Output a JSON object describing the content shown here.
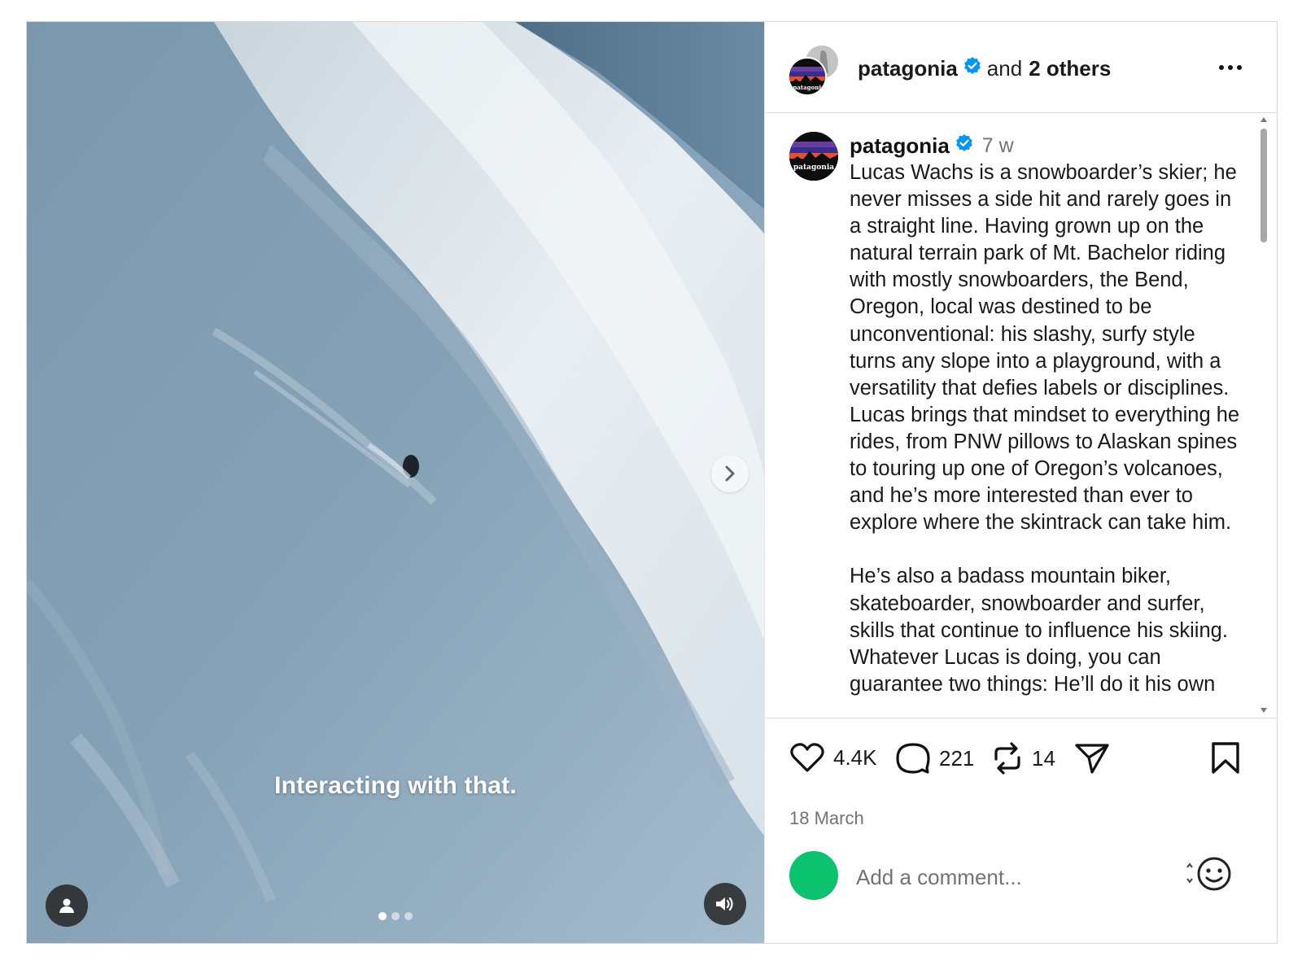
{
  "media": {
    "caption_overlay": "Interacting with that.",
    "carousel_total": 3,
    "carousel_active_index": 0,
    "next_icon": "chevron-right-icon",
    "tags_icon": "person-icon",
    "mute_icon": "volume-icon"
  },
  "header": {
    "username": "patagonia",
    "and_text": "and",
    "others_text": "2 others",
    "more_icon": "more-horizontal-icon"
  },
  "caption": {
    "username": "patagonia",
    "time": "7 w",
    "text": "Lucas Wachs is a snowboarder’s skier; he never misses a side hit and rarely goes in a straight line. Having grown up on the natural terrain park of Mt. Bachelor riding with mostly snowboarders, the Bend, Oregon, local was destined to be unconventional: his slashy, surfy style turns any slope into a playground, with a versatility that defies labels or disciplines. Lucas brings that mindset to everything he rides, from PNW pillows to Alaskan spines to touring up one of Oregon’s volcanoes, and he’s more interested than ever to explore where the skintrack can take him.\n\nHe’s also a badass mountain biker, skateboarder, snowboarder and surfer, skills that continue to influence his skiing. Whatever Lucas is doing, you can guarantee two things: He’ll do it his own"
  },
  "actions": {
    "likes": "4.4K",
    "comments": "221",
    "reposts": "14",
    "date": "18 March"
  },
  "comment_box": {
    "placeholder": "Add a comment..."
  },
  "colors": {
    "verified": "#0095f6",
    "avatar_green": "#0bc36f",
    "meta_gray": "#737373"
  }
}
